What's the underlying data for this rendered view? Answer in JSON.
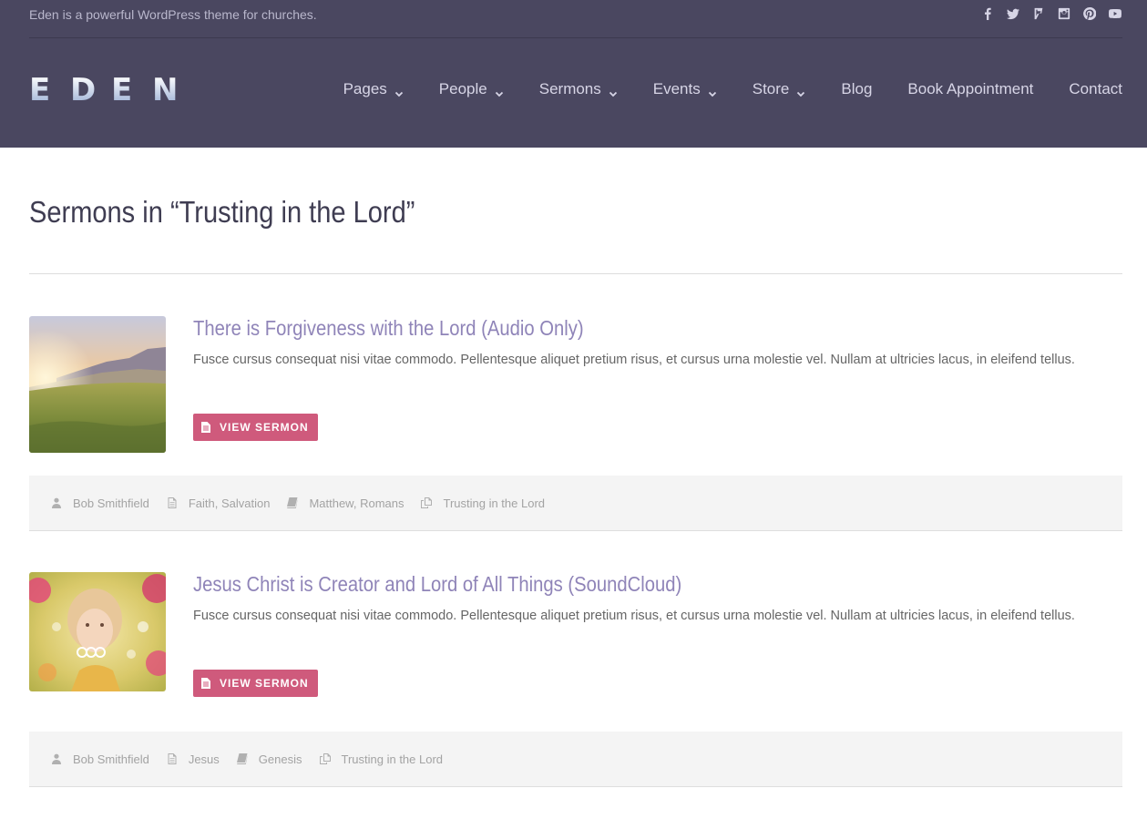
{
  "header": {
    "tagline": "Eden is a powerful WordPress theme for churches.",
    "social_icons": [
      "facebook-icon",
      "twitter-icon",
      "foursquare-icon",
      "instagram-icon",
      "pinterest-icon",
      "youtube-icon"
    ],
    "logo_letters": [
      "E",
      "D",
      "E",
      "N"
    ],
    "nav": [
      {
        "label": "Pages",
        "has_dropdown": true
      },
      {
        "label": "People",
        "has_dropdown": true
      },
      {
        "label": "Sermons",
        "has_dropdown": true
      },
      {
        "label": "Events",
        "has_dropdown": true
      },
      {
        "label": "Store",
        "has_dropdown": true
      },
      {
        "label": "Blog",
        "has_dropdown": false
      },
      {
        "label": "Book Appointment",
        "has_dropdown": false
      },
      {
        "label": "Contact",
        "has_dropdown": false
      }
    ]
  },
  "main": {
    "page_title": "Sermons in “Trusting in the Lord”",
    "sermons": [
      {
        "title": "There is Forgiveness with the Lord (Audio Only)",
        "excerpt": "Fusce cursus consequat nisi vitae commodo. Pellentesque aliquet pretium risus, et cursus urna molestie vel. Nullam at ultricies lacus, in eleifend tellus.",
        "button_label": "VIEW SERMON",
        "meta": {
          "speaker": "Bob Smithfield",
          "topics": "Faith, Salvation",
          "books": "Matthew, Romans",
          "series": "Trusting in the Lord"
        }
      },
      {
        "title": "Jesus Christ is Creator and Lord of All Things (SoundCloud)",
        "excerpt": "Fusce cursus consequat nisi vitae commodo. Pellentesque aliquet pretium risus, et cursus urna molestie vel. Nullam at ultricies lacus, in eleifend tellus.",
        "button_label": "VIEW SERMON",
        "meta": {
          "speaker": "Bob Smithfield",
          "topics": "Jesus",
          "books": "Genesis",
          "series": "Trusting in the Lord"
        }
      }
    ]
  },
  "colors": {
    "header_bg": "#4a4760",
    "title_accent": "#8f84b8",
    "button_bg": "#cf5a7c",
    "meta_bg": "#f4f4f4"
  }
}
